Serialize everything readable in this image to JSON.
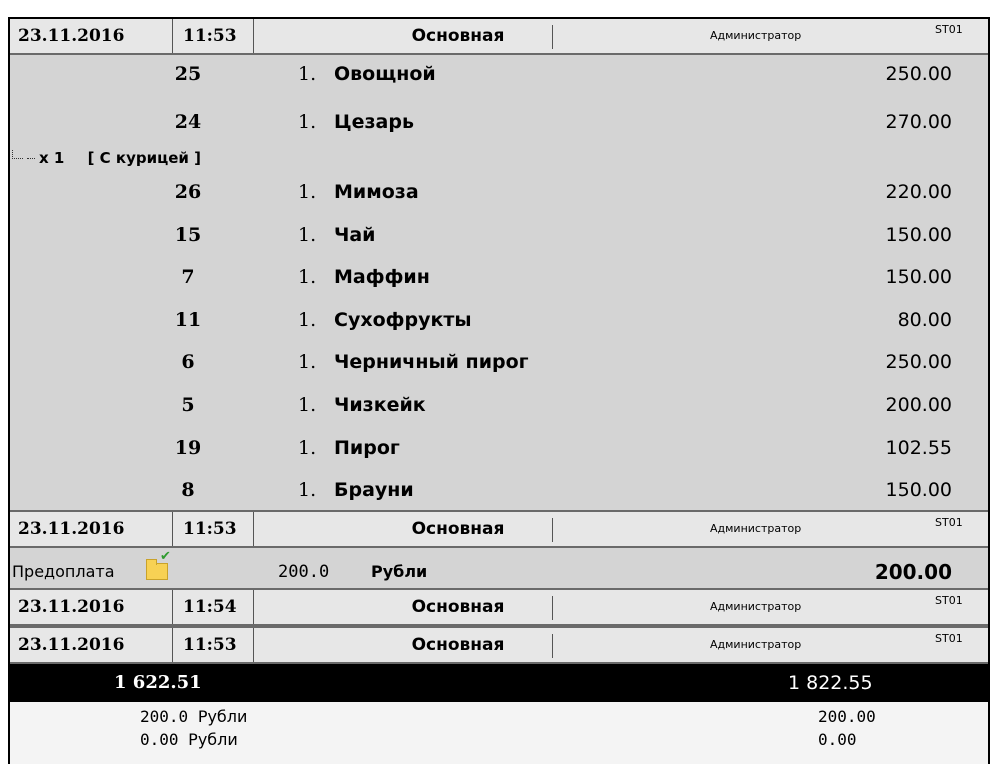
{
  "headers": [
    {
      "date": "23.11.2016",
      "time": "11:53",
      "tab": "Основная",
      "user": "Администратор",
      "terminal": "ST01"
    },
    {
      "date": "23.11.2016",
      "time": "11:53",
      "tab": "Основная",
      "user": "Администратор",
      "terminal": "ST01"
    },
    {
      "date": "23.11.2016",
      "time": "11:54",
      "tab": "Основная",
      "user": "Администратор",
      "terminal": "ST01"
    },
    {
      "date": "23.11.2016",
      "time": "11:53",
      "tab": "Основная",
      "user": "Администратор",
      "terminal": "ST01"
    }
  ],
  "items": [
    {
      "code": "25",
      "qty": "1.",
      "name": "Овощной",
      "price": "250.00"
    },
    {
      "code": "24",
      "qty": "1.",
      "name": "Цезарь",
      "price": "270.00"
    },
    {
      "code": "26",
      "qty": "1.",
      "name": "Мимоза",
      "price": "220.00"
    },
    {
      "code": "15",
      "qty": "1.",
      "name": "Чай",
      "price": "150.00"
    },
    {
      "code": "7",
      "qty": "1.",
      "name": "Маффин",
      "price": "150.00"
    },
    {
      "code": "11",
      "qty": "1.",
      "name": "Сухофрукты",
      "price": "80.00"
    },
    {
      "code": "6",
      "qty": "1.",
      "name": "Черничный пирог",
      "price": "250.00"
    },
    {
      "code": "5",
      "qty": "1.",
      "name": "Чизкейк",
      "price": "200.00"
    },
    {
      "code": "19",
      "qty": "1.",
      "name": "Пирог",
      "price": "102.55"
    },
    {
      "code": "8",
      "qty": "1.",
      "name": "Брауни",
      "price": "150.00"
    }
  ],
  "modifier": {
    "count": "x 1",
    "text": "[ С курицей ]"
  },
  "prepayment": {
    "label": "Предоплата",
    "amount": "200.0",
    "currency": "Рубли",
    "total": "200.00"
  },
  "totals": {
    "left": "1 622.51",
    "right": "1 822.55"
  },
  "payments": [
    {
      "amount": "200.0",
      "currency": "Рубли",
      "value": "200.00"
    },
    {
      "amount": "0.00",
      "currency": "Рубли",
      "value": "0.00"
    }
  ]
}
